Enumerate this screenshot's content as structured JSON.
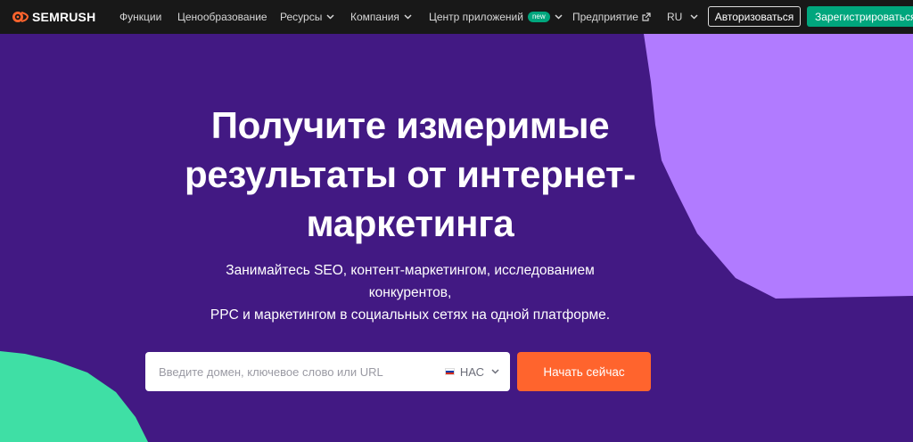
{
  "brand": {
    "name": "SEMRUSH",
    "logo_icon": "semrush-flame-icon",
    "accent": "#ff642d"
  },
  "nav": {
    "items": [
      {
        "label": "Функции",
        "dropdown": false
      },
      {
        "label": "Ценообразование",
        "dropdown": false
      },
      {
        "label": "Ресурсы",
        "dropdown": true
      },
      {
        "label": "Компания",
        "dropdown": true
      },
      {
        "label": "Центр приложений",
        "dropdown": true,
        "badge": "new"
      },
      {
        "label": "Предприятие",
        "external": true
      },
      {
        "label": "RU",
        "dropdown": true
      }
    ],
    "login_label": "Авторизоваться",
    "signup_label": "Зарегистрироваться"
  },
  "hero": {
    "title_lines": [
      "Получите измеримые",
      "результаты от интернет-",
      "маркетинга"
    ],
    "subtitle_lines": [
      "Занимайтесь SEO, контент-маркетингом, исследованием",
      "конкурентов,",
      "PPC и маркетингом в социальных сетях на одной платформе."
    ]
  },
  "search": {
    "placeholder": "Введите домен, ключевое слово или URL",
    "value": "",
    "database": "НАС",
    "database_flag": "ru-flag-icon"
  },
  "cta": {
    "label": "Начать сейчас"
  },
  "colors": {
    "hero_bg": "#421983",
    "nav_bg": "#181818",
    "green": "#00a67d",
    "lilac_shape": "#b17bff",
    "mint_shape": "#3fdfa5",
    "cta": "#ff642d"
  }
}
